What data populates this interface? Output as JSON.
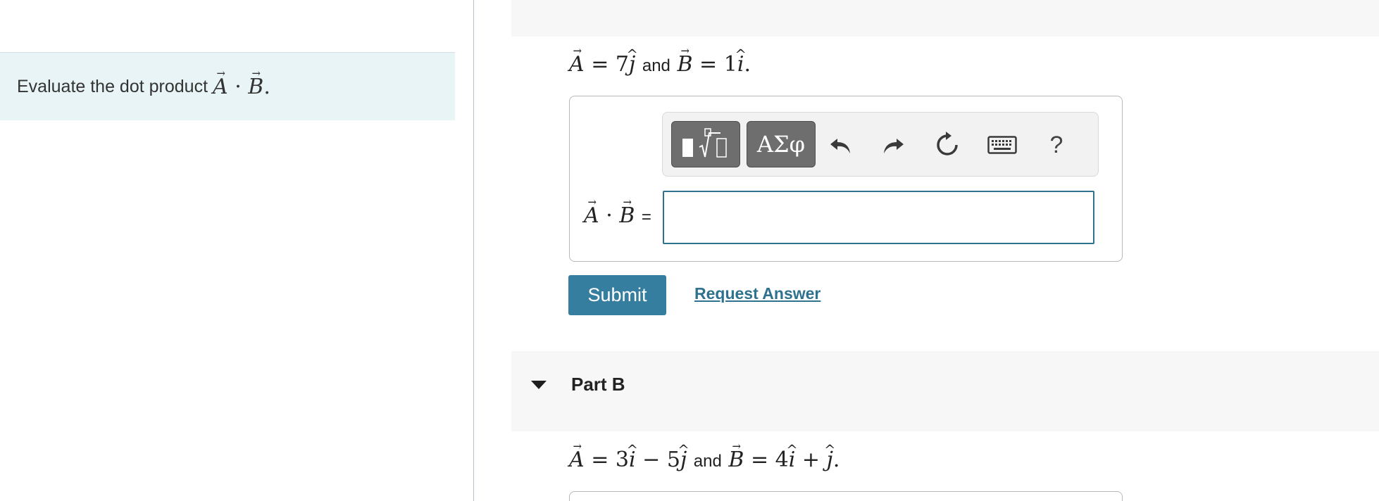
{
  "intro": {
    "text": "Evaluate the dot product",
    "math": {
      "a": "A",
      "dot": "·",
      "b": "B",
      "end": "."
    }
  },
  "part_a": {
    "statement": {
      "a": "A",
      "eq1": "=",
      "coef_a": "7",
      "unit_a": "j",
      "and": "and",
      "b": "B",
      "eq2": "=",
      "coef_b": "1",
      "unit_b": "i",
      "end": "."
    },
    "toolbar": {
      "templates_label": "√",
      "symbols_label": "ΑΣφ",
      "help_label": "?"
    },
    "answer_label": {
      "a": "A",
      "dot": "·",
      "b": "B",
      "eq": "="
    },
    "answer_value": "",
    "submit_label": "Submit",
    "request_label": "Request Answer"
  },
  "part_b": {
    "title": "Part B",
    "statement": {
      "a": "A",
      "eq1": "=",
      "t1": "3",
      "u1": "i",
      "minus": "−",
      "t2": "5",
      "u2": "j",
      "and": "and",
      "b": "B",
      "eq2": "=",
      "t3": "4",
      "u3": "i",
      "plus": "+",
      "u4": "j",
      "end": "."
    }
  },
  "colors": {
    "accent": "#367ea0",
    "link": "#2e7290",
    "intro_bg": "#e8f4f6",
    "toolbar_button": "#6e6e6e"
  },
  "icons": [
    "templates-icon",
    "undo-icon",
    "redo-icon",
    "reset-icon",
    "keyboard-icon",
    "help-icon",
    "caret-down-icon"
  ]
}
